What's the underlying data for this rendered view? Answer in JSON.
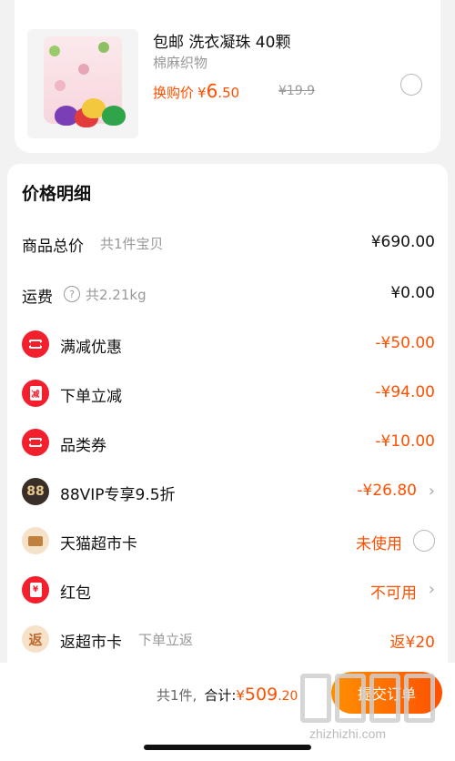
{
  "product": {
    "title": "包邮 洗衣凝珠 40颗",
    "subtitle": "棉麻织物",
    "price_label": "换购价",
    "price_symbol": "¥",
    "price_int": "6",
    "price_dec": ".50",
    "original_price": "¥19.9"
  },
  "detail": {
    "title": "价格明细",
    "rows": [
      {
        "label": "商品总价",
        "note": "共1件宝贝",
        "value": "¥690.00"
      },
      {
        "label": "运费",
        "note": "共2.21kg",
        "value": "¥0.00"
      },
      {
        "label": "满减优惠",
        "value": "-¥50.00"
      },
      {
        "label": "下单立减",
        "icon_text": "减",
        "value": "-¥94.00"
      },
      {
        "label": "品类券",
        "value": "-¥10.00"
      },
      {
        "label": "88VIP专享9.5折",
        "icon_text": "88",
        "value": "-¥26.80"
      },
      {
        "label": "天猫超市卡",
        "value": "未使用"
      },
      {
        "label": "红包",
        "icon_text": "¥",
        "value": "不可用"
      },
      {
        "label": "返超市卡",
        "icon_text": "返",
        "note": "下单立返",
        "value": "返¥20"
      }
    ]
  },
  "bottom": {
    "count": "共1件,",
    "total_label": "合计:",
    "total_symbol": "¥",
    "total_int": "509",
    "total_dec": ".20",
    "submit": "提交订单"
  },
  "watermark": {
    "text": "zhizhizhi.com"
  },
  "icons": {
    "coupon": "ticket-icon",
    "discount": "red-envelope-icon",
    "vip": "88vip-icon",
    "card": "gift-card-icon",
    "help": "question-icon",
    "chevron": "chevron-right-icon"
  },
  "colors": {
    "accent": "#ff5000",
    "badge_red": "#f21f2d"
  }
}
